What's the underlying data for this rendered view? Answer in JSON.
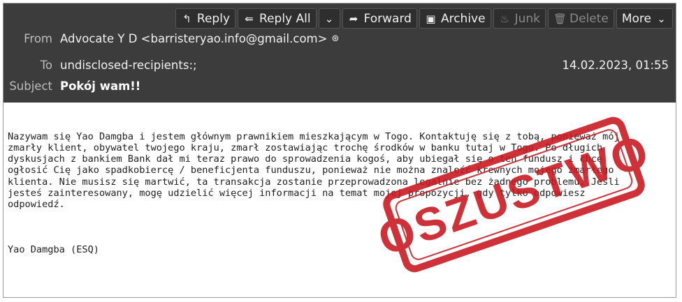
{
  "toolbar": {
    "reply": "Reply",
    "reply_all": "Reply All",
    "forward": "Forward",
    "archive": "Archive",
    "junk": "Junk",
    "delete": "Delete",
    "more": "More"
  },
  "header": {
    "from_label": "From",
    "from_value": "Advocate Y D <barristeryao.info@gmail.com>",
    "to_label": "To",
    "to_value": "undisclosed-recipients:;",
    "date": "14.02.2023, 01:55",
    "subject_label": "Subject",
    "subject_value": "Pokój wam!!"
  },
  "message": {
    "body": "Nazywam się Yao Damgba i jestem głównym prawnikiem mieszkającym w Togo. Kontaktuję się z tobą, ponieważ mój\nzmarły klient, obywatel twojego kraju, zmarł zostawiając trochę środków w banku tutaj w Togo. Po długich\ndyskusjach z bankiem Bank dał mi teraz prawo do sprowadzenia kogoś, aby ubiegał się o ten fundusz i chcę\nogłosić Cię jako spadkobiercę / beneficjenta funduszu, ponieważ nie można znaleźć krewnych mojego zmarłego\nklienta. Nie musisz się martwić, ta transakcja zostanie przeprowadzona legalnie bez żadnego problemu. Jeśli\njesteś zainteresowany, mogę udzielić więcej informacji na temat mojej propozycji, gdy tylko odpowiesz\nodpowiedź.",
    "signature": "Yao Damgba (ESQ)"
  },
  "stamp": {
    "text": "OSZUSTWO",
    "color": "#c8161d"
  },
  "colors": {
    "header_bg": "#3c3c3c",
    "stamp_red": "#c8161d"
  }
}
